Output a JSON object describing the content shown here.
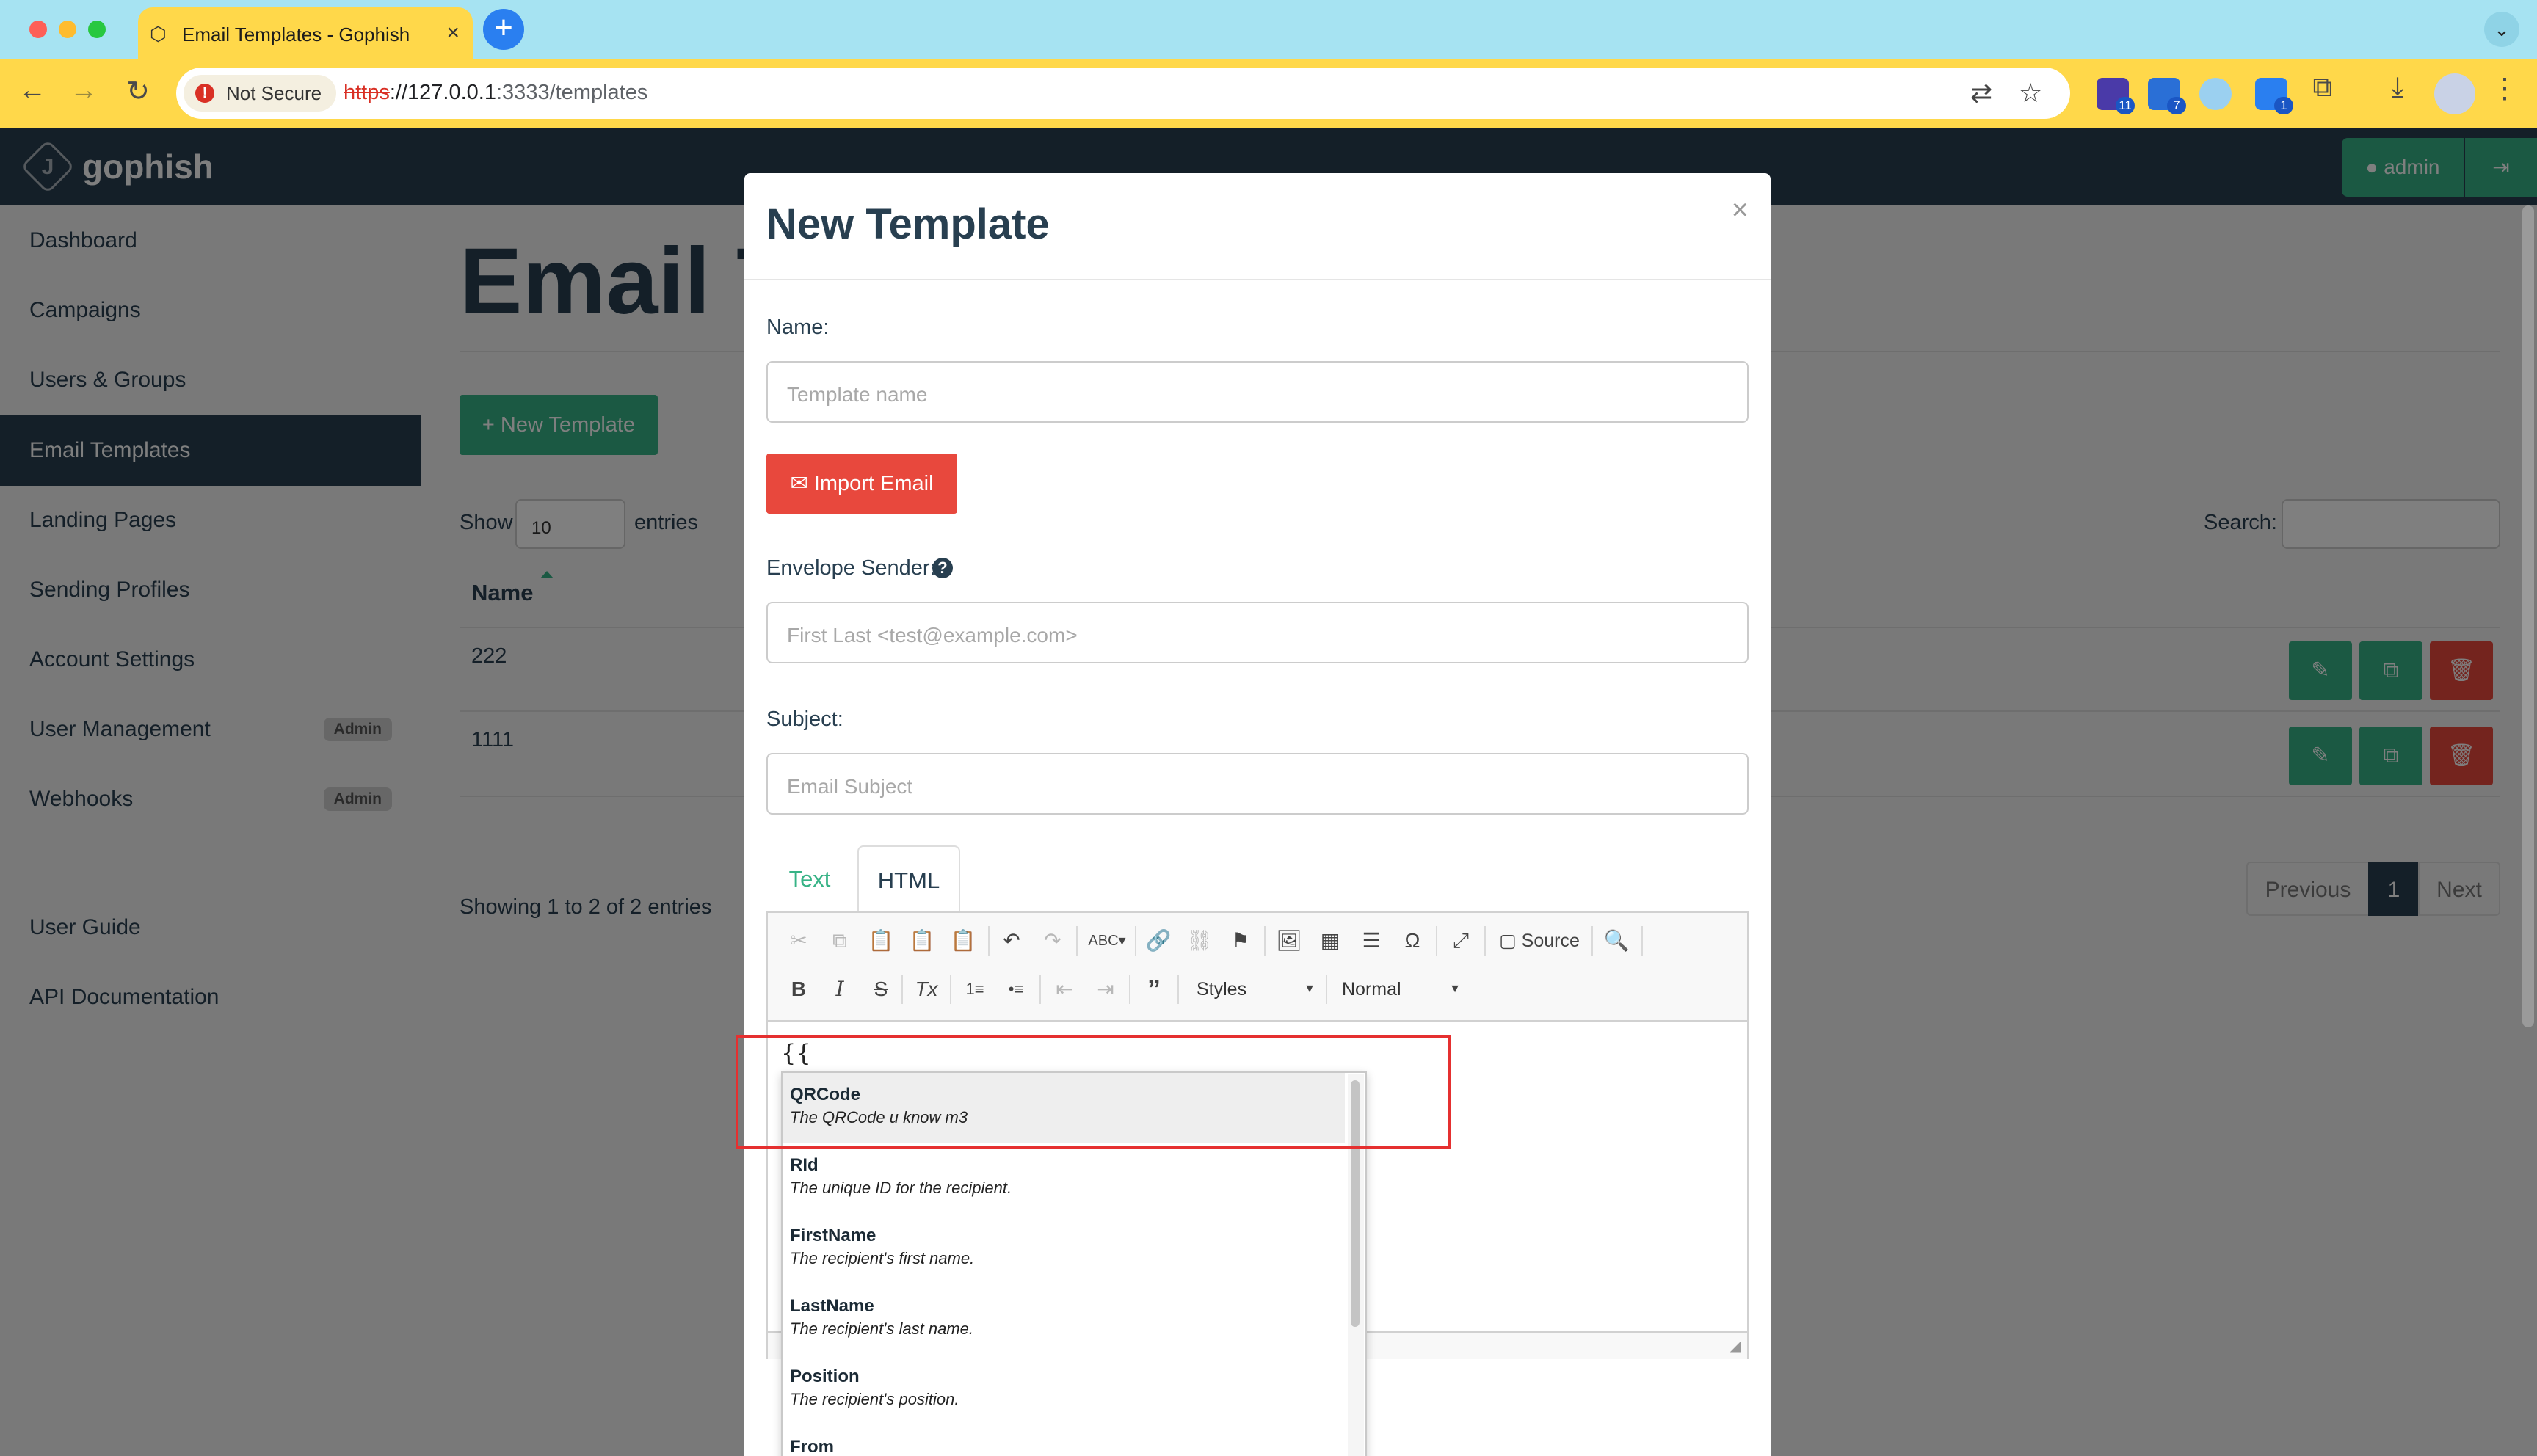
{
  "browser": {
    "tab_title": "Email Templates - Gophish",
    "security_label": "Not Secure",
    "url_scheme": "https",
    "url_host": "://127.0.0.1",
    "url_rest": ":3333/templates",
    "extensions": [
      {
        "name": "extension-1",
        "badge": "11",
        "color": "#4a3aa8"
      },
      {
        "name": "extension-2",
        "badge": "7",
        "color": "#2a6fd6"
      },
      {
        "name": "extension-3",
        "badge": "",
        "color": "#9bd0f0"
      },
      {
        "name": "extension-4",
        "badge": "1",
        "color": "#2a7ff0"
      }
    ]
  },
  "app": {
    "brand": "gophish",
    "admin_label": "admin"
  },
  "sidebar": {
    "items": [
      {
        "label": "Dashboard"
      },
      {
        "label": "Campaigns"
      },
      {
        "label": "Users & Groups"
      },
      {
        "label": "Email Templates",
        "active": true
      },
      {
        "label": "Landing Pages"
      },
      {
        "label": "Sending Profiles"
      },
      {
        "label": "Account Settings"
      },
      {
        "label": "User Management",
        "badge": "Admin"
      },
      {
        "label": "Webhooks",
        "badge": "Admin"
      }
    ],
    "footer_items": [
      {
        "label": "User Guide"
      },
      {
        "label": "API Documentation"
      }
    ]
  },
  "main": {
    "title": "Email Templates",
    "new_button": "New Template",
    "show_label": "Show",
    "show_value": "10",
    "entries_label": "entries",
    "search_label": "Search:",
    "column_name": "Name",
    "rows": [
      {
        "name": "222"
      },
      {
        "name": "1111"
      }
    ],
    "showing": "Showing 1 to 2 of 2 entries",
    "pagination": {
      "previous": "Previous",
      "page": "1",
      "next": "Next"
    }
  },
  "modal": {
    "title": "New Template",
    "close": "×",
    "name_label": "Name:",
    "name_placeholder": "Template name",
    "import_button": "Import Email",
    "envelope_label": "Envelope Sender:",
    "envelope_placeholder": "First Last <test@example.com>",
    "subject_label": "Subject:",
    "subject_placeholder": "Email Subject",
    "tabs": {
      "text": "Text",
      "html": "HTML"
    },
    "editor": {
      "source_label": "Source",
      "styles_label": "Styles",
      "format_label": "Normal",
      "content": "{{"
    },
    "suggestions": [
      {
        "name": "QRCode",
        "desc": "The QRCode u know m3"
      },
      {
        "name": "RId",
        "desc": "The unique ID for the recipient."
      },
      {
        "name": "FirstName",
        "desc": "The recipient's first name."
      },
      {
        "name": "LastName",
        "desc": "The recipient's last name."
      },
      {
        "name": "Position",
        "desc": "The recipient's position."
      },
      {
        "name": "From",
        "desc": ""
      }
    ]
  }
}
